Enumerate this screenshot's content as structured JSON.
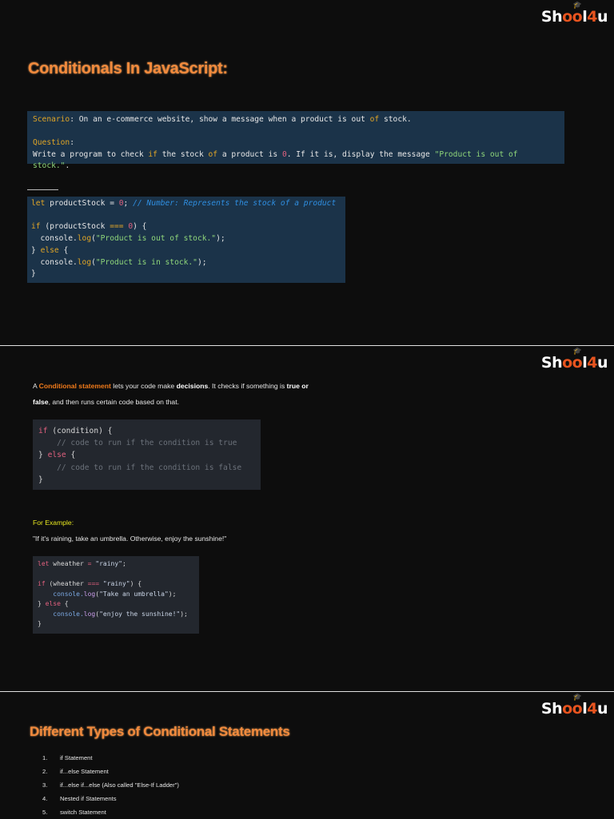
{
  "logo": "School4U",
  "slide1": {
    "title": "Conditionals In JavaScript:",
    "scenario_label": "Scenario",
    "scenario_text": ": On an e-commerce website, show a message when a product is out ",
    "scenario_of": "of",
    "scenario_end": " stock.",
    "question_label": "Question",
    "question_colon": ":",
    "q1": "Write a program to check ",
    "q_if": "if",
    "q2": " the stock ",
    "q_of": "of",
    "q3": " a product is ",
    "q_zero": "0",
    "q4": ". If it is, display the message ",
    "q_str": "\"Product is out of stock.\"",
    "q5": ".",
    "code": [
      [
        [
          "let",
          "y"
        ],
        [
          " productStock = ",
          "w"
        ],
        [
          "0",
          "r"
        ],
        [
          "; ",
          "w"
        ],
        [
          "// Number: Represents the stock of a product",
          "c"
        ]
      ],
      [],
      [
        [
          "if",
          "y"
        ],
        [
          " (productStock ",
          "w"
        ],
        [
          "===",
          "y"
        ],
        [
          " ",
          "w"
        ],
        [
          "0",
          "r"
        ],
        [
          ") {",
          "w"
        ]
      ],
      [
        [
          "  console.",
          "w"
        ],
        [
          "log",
          "y"
        ],
        [
          "(",
          "w"
        ],
        [
          "\"Product is out of stock.\"",
          "g"
        ],
        [
          ");",
          "w"
        ]
      ],
      [
        [
          "} ",
          "w"
        ],
        [
          "else",
          "y"
        ],
        [
          " {",
          "w"
        ]
      ],
      [
        [
          "  console.",
          "w"
        ],
        [
          "log",
          "y"
        ],
        [
          "(",
          "w"
        ],
        [
          "\"Product is in stock.\"",
          "g"
        ],
        [
          ");",
          "w"
        ]
      ],
      [
        [
          "}",
          "w"
        ]
      ]
    ]
  },
  "slide2": {
    "p1a": "A ",
    "p1b": "Conditional statement",
    "p1c": " lets your code make ",
    "p1d": "decisions",
    "p1e": ". It checks if something is ",
    "p1f": "true or",
    "p2a": "false",
    "p2b": ", and then runs certain code based on that.",
    "code": [
      [
        [
          "if",
          "k"
        ],
        [
          " (condition) {",
          "t"
        ]
      ],
      [
        [
          "    // code to run if the condition is true",
          "cm"
        ]
      ],
      [
        [
          "} ",
          "t"
        ],
        [
          "else",
          "k"
        ],
        [
          " {",
          "t"
        ]
      ],
      [
        [
          "    // code to run if the condition is false",
          "cm"
        ]
      ],
      [
        [
          "}",
          "t"
        ]
      ]
    ],
    "example_label": "For Example:",
    "example_quote": "\"If it's raining, take an umbrella. Otherwise, enjoy the sunshine!\"",
    "code2": [
      [
        [
          "let",
          "k"
        ],
        [
          " wheather ",
          "t"
        ],
        [
          "=",
          "k"
        ],
        [
          " ",
          "t"
        ],
        [
          "\"rainy\"",
          "s"
        ],
        [
          ";",
          "t"
        ]
      ],
      [],
      [
        [
          "if",
          "k"
        ],
        [
          " (wheather ",
          "t"
        ],
        [
          "===",
          "k"
        ],
        [
          " ",
          "t"
        ],
        [
          "\"rainy\"",
          "s"
        ],
        [
          ") {",
          "t"
        ]
      ],
      [
        [
          "    console.",
          "f"
        ],
        [
          "log",
          "p"
        ],
        [
          "(",
          "t"
        ],
        [
          "\"Take an umbrella\"",
          "s"
        ],
        [
          ");",
          "t"
        ]
      ],
      [
        [
          "} ",
          "t"
        ],
        [
          "else",
          "k"
        ],
        [
          " {",
          "t"
        ]
      ],
      [
        [
          "    console.",
          "f"
        ],
        [
          "log",
          "p"
        ],
        [
          "(",
          "t"
        ],
        [
          "\"enjoy the sunshine!\"",
          "s"
        ],
        [
          ");",
          "t"
        ]
      ],
      [
        [
          "}",
          "t"
        ]
      ]
    ]
  },
  "slide3": {
    "title": "Different Types of Conditional Statements",
    "items": [
      {
        "num": "1.",
        "label": "if Statement"
      },
      {
        "num": "2.",
        "label": "if...else Statement"
      },
      {
        "num": "3.",
        "label": "if...else if...else (Also called \"Else-If Ladder\")"
      },
      {
        "num": "4.",
        "label": "Nested if Statements"
      },
      {
        "num": "5.",
        "label": "switch Statement"
      }
    ]
  }
}
